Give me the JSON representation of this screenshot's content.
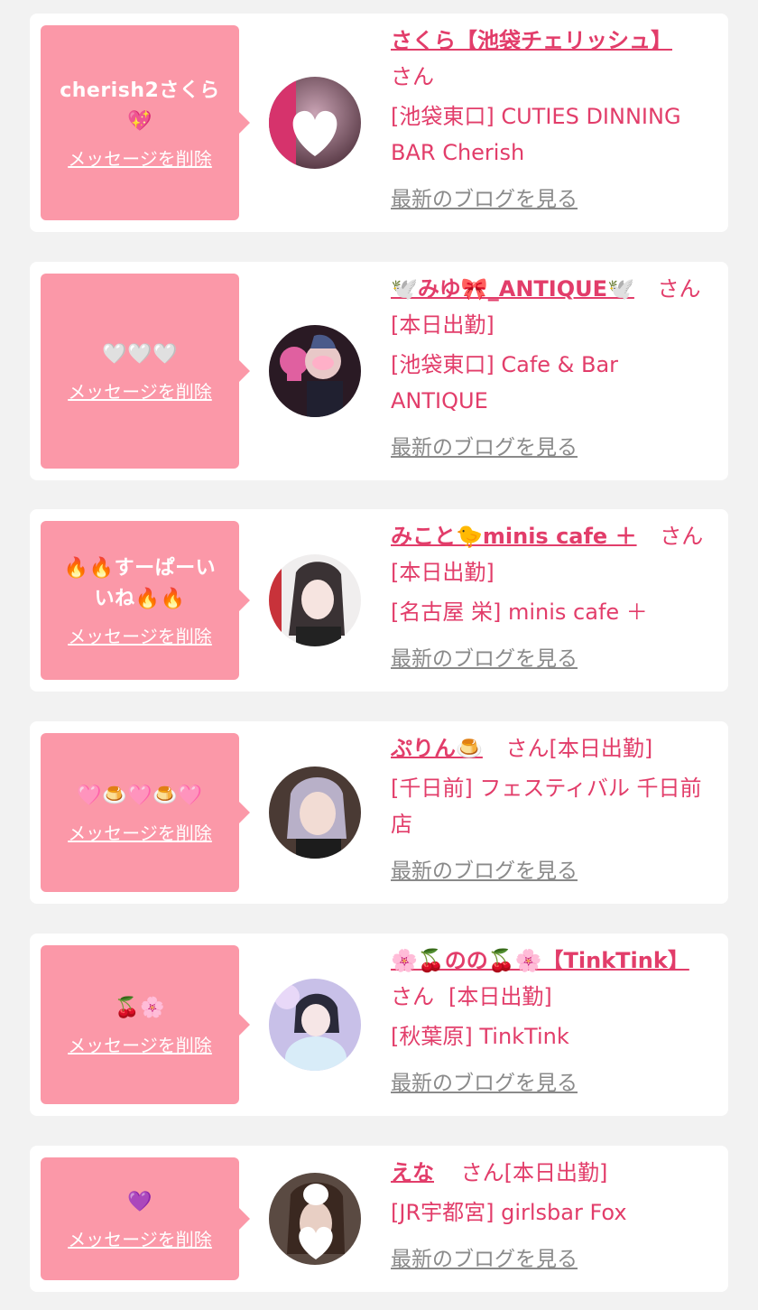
{
  "colors": {
    "bubble": "#fb98a8",
    "accent": "#e23d6a",
    "blog_link": "#8a8a8a",
    "background": "#f2f2f2"
  },
  "items": [
    {
      "message": "cherish2さくら💖",
      "delete_label": "メッセージを削除",
      "name": "さくら【池袋チェリッシュ】",
      "san": "さん",
      "badge": "",
      "shop": "[池袋東口] CUTIES DINNING BAR Cherish",
      "blog_label": "最新のブログを見る",
      "avatar_icon": "heart-photo-avatar"
    },
    {
      "message": "🤍🤍🤍",
      "delete_label": "メッセージを削除",
      "name": "🕊️みゆ🎀_ANTIQUE🕊️",
      "san": "さん",
      "badge": "[本日出勤]",
      "shop": "[池袋東口] Cafe & Bar ANTIQUE",
      "blog_label": "最新のブログを見る",
      "avatar_icon": "skull-photo-avatar"
    },
    {
      "message": "🔥🔥すーぱーいいね🔥🔥",
      "delete_label": "メッセージを削除",
      "name": "みこと🐤minis cafe ＋",
      "san": "さん",
      "badge": "[本日出勤]",
      "shop": "[名古屋 栄] minis cafe ＋",
      "blog_label": "最新のブログを見る",
      "avatar_icon": "portrait-photo-avatar"
    },
    {
      "message": "🩷🍮🩷🍮🩷",
      "delete_label": "メッセージを削除",
      "name": "ぷりん🍮",
      "san": "さん",
      "badge": "[本日出勤]",
      "shop": "[千日前] フェスティバル 千日前店",
      "blog_label": "最新のブログを見る",
      "avatar_icon": "portrait-photo-avatar"
    },
    {
      "message": "🍒🌸",
      "delete_label": "メッセージを削除",
      "name": "🌸🍒のの🍒🌸【TinkTink】",
      "san": "さん",
      "badge": "[本日出勤]",
      "shop": "[秋葉原] TinkTink",
      "blog_label": "最新のブログを見る",
      "avatar_icon": "portrait-photo-avatar"
    },
    {
      "message": "💜",
      "delete_label": "メッセージを削除",
      "name": "えな",
      "san": "さん",
      "badge": "[本日出勤]",
      "shop": "[JR宇都宮] girlsbar Fox",
      "blog_label": "最新のブログを見る",
      "avatar_icon": "heart-photo-avatar"
    }
  ]
}
